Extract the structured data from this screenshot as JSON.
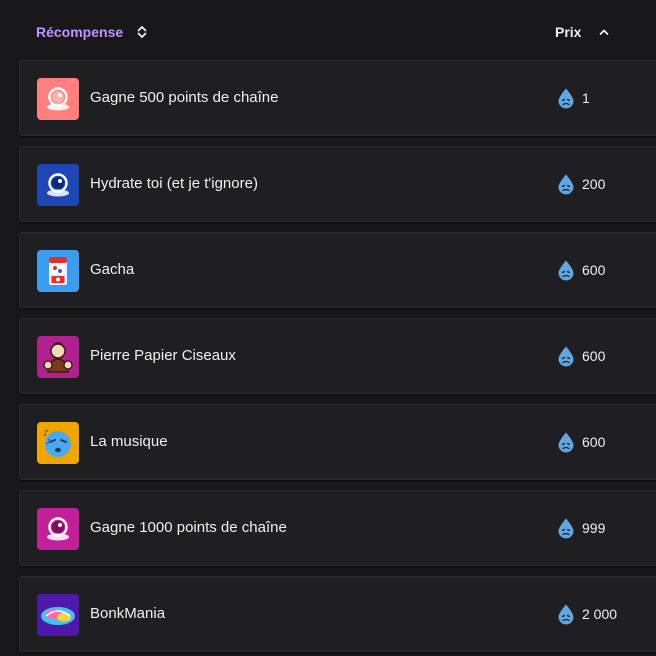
{
  "header": {
    "reward_label": "Récompense",
    "reward_sort_icon": "sort-updown-icon",
    "price_label": "Prix",
    "price_sort_icon": "chevron-up-icon"
  },
  "colors": {
    "accent": "#bf94ff",
    "background": "#18181b",
    "row_bg": "#1f1f23",
    "drop": "#5fa6e2"
  },
  "rewards": [
    {
      "title": "Gagne 500 points de chaîne",
      "price": "1",
      "icon": "crystal-ball-icon",
      "icon_bg": "#ff7f7f"
    },
    {
      "title": "Hydrate toi (et je t'ignore)",
      "price": "200",
      "icon": "crystal-ball-icon",
      "icon_bg": "#1e47b5"
    },
    {
      "title": "Gacha",
      "price": "600",
      "icon": "gacha-machine-icon",
      "icon_bg": "#3d9bf0"
    },
    {
      "title": "Pierre Papier Ciseaux",
      "price": "600",
      "icon": "character-icon",
      "icon_bg": "#b0208f"
    },
    {
      "title": "La musique",
      "price": "600",
      "icon": "music-face-icon",
      "icon_bg": "#f0a500"
    },
    {
      "title": "Gagne 1000 points de chaîne",
      "price": "999",
      "icon": "crystal-ball-icon",
      "icon_bg": "#c21f9b"
    },
    {
      "title": "BonkMania",
      "price": "2 000",
      "icon": "bonkmania-logo-icon",
      "icon_bg": "#5018a8"
    }
  ]
}
